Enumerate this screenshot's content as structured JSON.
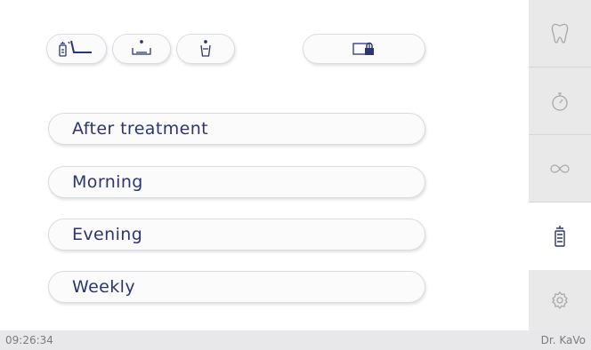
{
  "top_icons": [
    {
      "icon": "spray-chair-icon"
    },
    {
      "icon": "basin-drop-icon"
    },
    {
      "icon": "cup-drop-icon"
    },
    {
      "icon": "display-lock-icon"
    }
  ],
  "programs": [
    {
      "label": "After treatment"
    },
    {
      "label": "Morning"
    },
    {
      "label": "Evening"
    },
    {
      "label": "Weekly"
    }
  ],
  "sidebar": {
    "items": [
      {
        "icon": "tooth-icon",
        "active": false
      },
      {
        "icon": "stopwatch-icon",
        "active": false
      },
      {
        "icon": "infinity-icon",
        "active": false
      },
      {
        "icon": "spray-bottle-icon",
        "active": true
      },
      {
        "icon": "gear-icon",
        "active": false
      }
    ]
  },
  "status": {
    "time": "09:26:34",
    "user": "Dr. KaVo"
  },
  "colors": {
    "accent": "#2b3570",
    "sidebar_bg": "#e9e9ea",
    "statusbar_bg": "#e8e8ea",
    "icon_inactive": "#a8a8ad"
  }
}
